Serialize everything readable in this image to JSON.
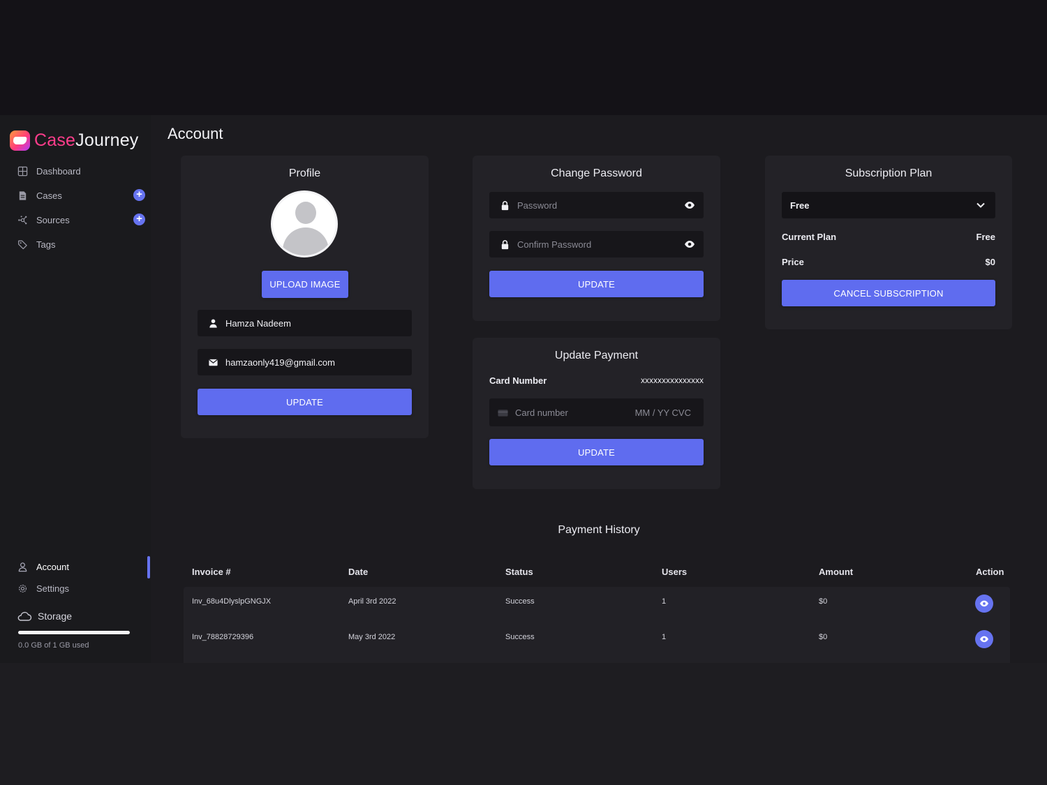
{
  "app": {
    "logo_case": "Case",
    "logo_journey": "Journey"
  },
  "sidebar": {
    "items": [
      {
        "label": "Dashboard",
        "icon": "dashboard-grid-icon"
      },
      {
        "label": "Cases",
        "icon": "case-file-icon"
      },
      {
        "label": "Sources",
        "icon": "sources-network-icon"
      },
      {
        "label": "Tags",
        "icon": "tag-icon"
      }
    ],
    "bottom_items": [
      {
        "label": "Account",
        "icon": "user-icon",
        "active": true
      },
      {
        "label": "Settings",
        "icon": "gear-icon"
      }
    ],
    "storage": {
      "label": "Storage",
      "used_text": "0.0 GB of 1 GB used",
      "used_fraction": 0.0
    }
  },
  "page": {
    "title": "Account"
  },
  "profile": {
    "title": "Profile",
    "upload_label": "UPLOAD IMAGE",
    "name_value": "Hamza Nadeem",
    "email_value": "hamzaonly419@gmail.com",
    "update_label": "UPDATE"
  },
  "change_password": {
    "title": "Change Password",
    "password_placeholder": "Password",
    "confirm_placeholder": "Confirm Password",
    "update_label": "UPDATE"
  },
  "subscription": {
    "title": "Subscription Plan",
    "selected_plan": "Free",
    "current_plan_label": "Current Plan",
    "current_plan_value": "Free",
    "price_label": "Price",
    "price_value": "$0",
    "cancel_label": "CANCEL SUBSCRIPTION"
  },
  "update_payment": {
    "title": "Update Payment",
    "card_number_label": "Card Number",
    "card_number_value": "xxxxxxxxxxxxxxx",
    "card_placeholder": "Card number",
    "expiry_cvc_placeholder": "MM / YY  CVC",
    "update_label": "UPDATE"
  },
  "payment_history": {
    "title": "Payment History",
    "columns": [
      "Invoice #",
      "Date",
      "Status",
      "Users",
      "Amount",
      "Action"
    ],
    "rows": [
      {
        "invoice": "Inv_68u4DlyslpGNGJX",
        "date": "April 3rd 2022",
        "status": "Success",
        "users": "1",
        "amount": "$0"
      },
      {
        "invoice": "Inv_78828729396",
        "date": "May 3rd 2022",
        "status": "Success",
        "users": "1",
        "amount": "$0"
      }
    ]
  },
  "colors": {
    "accent": "#5f6cef",
    "background": "#1c1b1f",
    "card": "#232227",
    "logo_pink": "#ff3d8b"
  }
}
